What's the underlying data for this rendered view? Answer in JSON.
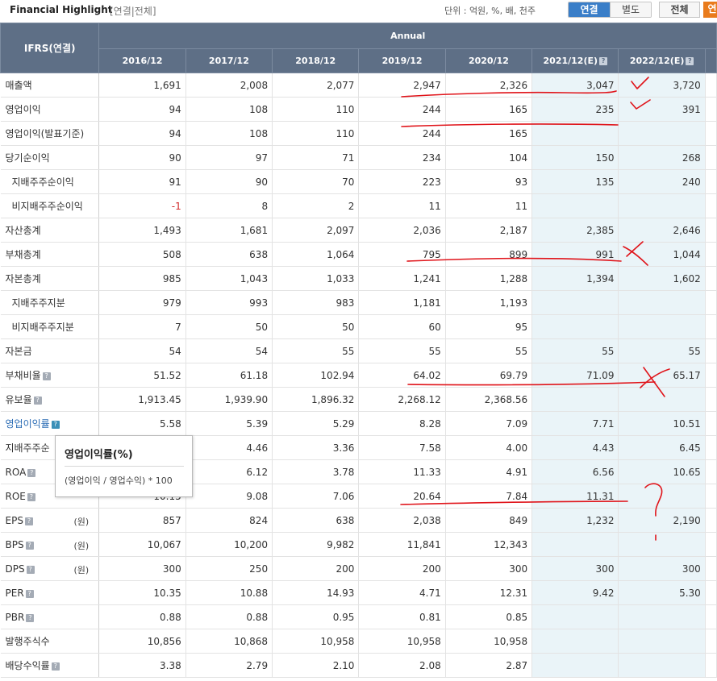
{
  "header": {
    "title": "Financial Highlight",
    "subtitle": "[연결|전체]",
    "unit_text": "단위 : 억원, %, 배, 천주",
    "toggle_consolidated": "연결",
    "toggle_separate": "별도",
    "toggle_all": "전체",
    "toggle_annual_cut": "연"
  },
  "table": {
    "corner_label": "IFRS(연결)",
    "group_label": "Annual",
    "columns": [
      "2016/12",
      "2017/12",
      "2018/12",
      "2019/12",
      "2020/12",
      "2021/12(E)",
      "2022/12(E)"
    ],
    "estimate_help_icon": "help-icon",
    "rows": [
      {
        "label": "매출액",
        "values": [
          "1,691",
          "2,008",
          "2,077",
          "2,947",
          "2,326",
          "3,047",
          "3,720"
        ]
      },
      {
        "label": "영업이익",
        "values": [
          "94",
          "108",
          "110",
          "244",
          "165",
          "235",
          "391"
        ]
      },
      {
        "label": "영업이익(발표기준)",
        "values": [
          "94",
          "108",
          "110",
          "244",
          "165",
          "",
          ""
        ]
      },
      {
        "label": "당기순이익",
        "values": [
          "90",
          "97",
          "71",
          "234",
          "104",
          "150",
          "268"
        ]
      },
      {
        "label": "지배주주순이익",
        "values": [
          "91",
          "90",
          "70",
          "223",
          "93",
          "135",
          "240"
        ]
      },
      {
        "label": "비지배주주순이익",
        "values": [
          "-1",
          "8",
          "2",
          "11",
          "11",
          "",
          ""
        ]
      },
      {
        "label": "자산총계",
        "values": [
          "1,493",
          "1,681",
          "2,097",
          "2,036",
          "2,187",
          "2,385",
          "2,646"
        ]
      },
      {
        "label": "부채총계",
        "values": [
          "508",
          "638",
          "1,064",
          "795",
          "899",
          "991",
          "1,044"
        ]
      },
      {
        "label": "자본총계",
        "values": [
          "985",
          "1,043",
          "1,033",
          "1,241",
          "1,288",
          "1,394",
          "1,602"
        ]
      },
      {
        "label": "지배주주지분",
        "values": [
          "979",
          "993",
          "983",
          "1,181",
          "1,193",
          "",
          ""
        ]
      },
      {
        "label": "비지배주주지분",
        "values": [
          "7",
          "50",
          "50",
          "60",
          "95",
          "",
          ""
        ]
      },
      {
        "label": "자본금",
        "values": [
          "54",
          "54",
          "55",
          "55",
          "55",
          "55",
          "55"
        ]
      },
      {
        "label": "부채비율",
        "values": [
          "51.52",
          "61.18",
          "102.94",
          "64.02",
          "69.79",
          "71.09",
          "65.17"
        ]
      },
      {
        "label": "유보율",
        "values": [
          "1,913.45",
          "1,939.90",
          "1,896.32",
          "2,268.12",
          "2,368.56",
          "",
          ""
        ]
      },
      {
        "label": "영업이익률",
        "values": [
          "5.58",
          "5.39",
          "5.29",
          "8.28",
          "7.09",
          "7.71",
          "10.51"
        ]
      },
      {
        "label": "지배주주순",
        "values": [
          "",
          "4.46",
          "3.36",
          "7.58",
          "4.00",
          "4.43",
          "6.45"
        ]
      },
      {
        "label": "ROA",
        "values": [
          "",
          "6.12",
          "3.78",
          "11.33",
          "4.91",
          "6.56",
          "10.65"
        ]
      },
      {
        "label": "ROE",
        "values": [
          "10.15",
          "9.08",
          "7.06",
          "20.64",
          "7.84",
          "11.31",
          ""
        ]
      },
      {
        "label": "EPS",
        "unit": "(원)",
        "values": [
          "857",
          "824",
          "638",
          "2,038",
          "849",
          "1,232",
          "2,190"
        ]
      },
      {
        "label": "BPS",
        "unit": "(원)",
        "values": [
          "10,067",
          "10,200",
          "9,982",
          "11,841",
          "12,343",
          "",
          ""
        ]
      },
      {
        "label": "DPS",
        "unit": "(원)",
        "values": [
          "300",
          "250",
          "200",
          "200",
          "300",
          "300",
          "300"
        ]
      },
      {
        "label": "PER",
        "values": [
          "10.35",
          "10.88",
          "14.93",
          "4.71",
          "12.31",
          "9.42",
          "5.30"
        ]
      },
      {
        "label": "PBR",
        "values": [
          "0.88",
          "0.88",
          "0.95",
          "0.81",
          "0.85",
          "",
          ""
        ]
      },
      {
        "label": "발행주식수",
        "values": [
          "10,856",
          "10,868",
          "10,958",
          "10,958",
          "10,958",
          "",
          ""
        ]
      },
      {
        "label": "배당수익률",
        "values": [
          "3.38",
          "2.79",
          "2.10",
          "2.08",
          "2.87",
          "",
          ""
        ]
      }
    ]
  },
  "tooltip": {
    "title": "영업이익률(%)",
    "body": "(영업이익 / 영업수익) * 100"
  },
  "annotation_color": "#e0141a",
  "annotation_marks": [
    "✓",
    "✓",
    "X",
    "X",
    "?"
  ]
}
